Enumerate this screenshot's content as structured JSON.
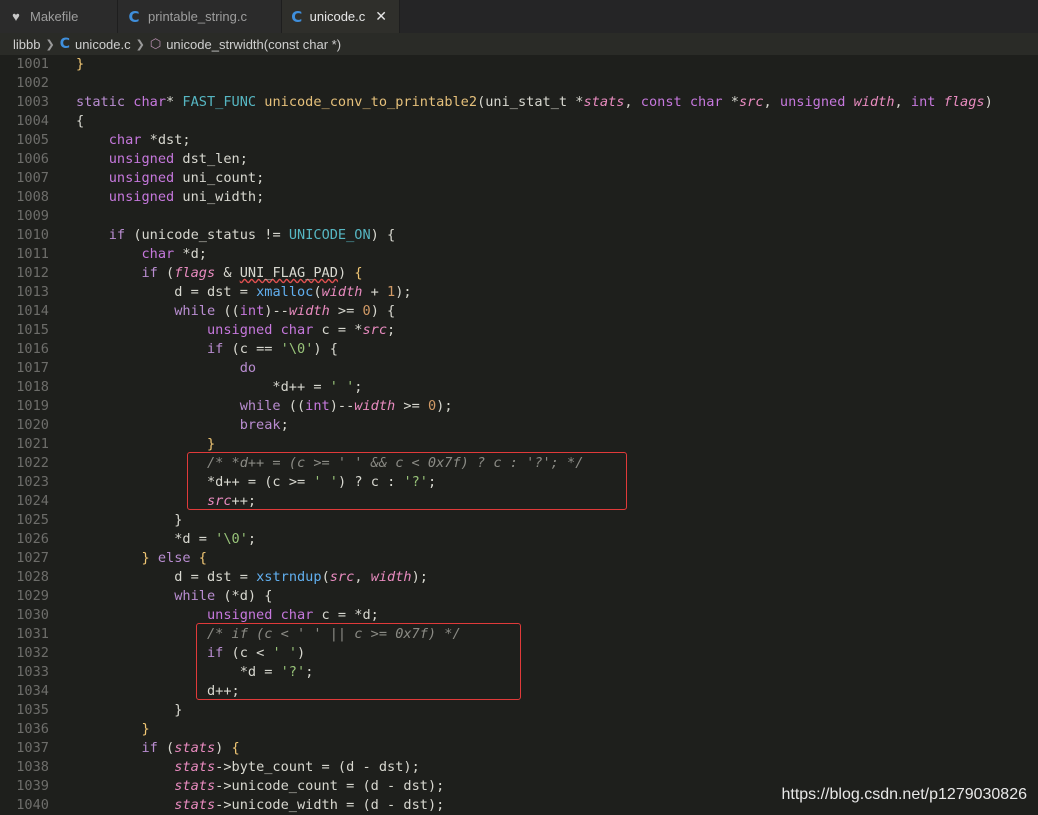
{
  "tabs": [
    {
      "label": "Makefile",
      "icon": "makefile-icon",
      "active": false
    },
    {
      "label": "printable_string.c",
      "icon": "c-file-icon",
      "active": false
    },
    {
      "label": "unicode.c",
      "icon": "c-file-icon",
      "active": true,
      "close": "✕"
    }
  ],
  "breadcrumb": {
    "folder": "libbb",
    "file": "unicode.c",
    "symbol": "unicode_strwidth(const char *)"
  },
  "lines": [
    {
      "n": "1001",
      "tokens": [
        [
          "brace",
          "}"
        ]
      ]
    },
    {
      "n": "1002",
      "tokens": []
    },
    {
      "n": "1003",
      "tokens": [
        [
          "kw",
          "static "
        ],
        [
          "type",
          "char"
        ],
        [
          "plain",
          "* "
        ],
        [
          "const",
          "FAST_FUNC "
        ],
        [
          "fn",
          "unicode_conv_to_printable2"
        ],
        [
          "plain",
          "("
        ],
        [
          "plain",
          "uni_stat_t "
        ],
        [
          "op",
          "*"
        ],
        [
          "param",
          "stats"
        ],
        [
          "plain",
          ", "
        ],
        [
          "type",
          "const char "
        ],
        [
          "op",
          "*"
        ],
        [
          "param",
          "src"
        ],
        [
          "plain",
          ", "
        ],
        [
          "type",
          "unsigned "
        ],
        [
          "param",
          "width"
        ],
        [
          "plain",
          ", "
        ],
        [
          "type",
          "int "
        ],
        [
          "param",
          "flags"
        ],
        [
          "plain",
          ")"
        ]
      ]
    },
    {
      "n": "1004",
      "tokens": [
        [
          "plain",
          "{"
        ]
      ]
    },
    {
      "n": "1005",
      "tokens": [
        [
          "plain",
          "    "
        ],
        [
          "type",
          "char "
        ],
        [
          "op",
          "*"
        ],
        [
          "plain",
          "dst;"
        ]
      ]
    },
    {
      "n": "1006",
      "tokens": [
        [
          "plain",
          "    "
        ],
        [
          "type",
          "unsigned "
        ],
        [
          "plain",
          "dst_len;"
        ]
      ]
    },
    {
      "n": "1007",
      "tokens": [
        [
          "plain",
          "    "
        ],
        [
          "type",
          "unsigned "
        ],
        [
          "plain",
          "uni_count;"
        ]
      ]
    },
    {
      "n": "1008",
      "tokens": [
        [
          "plain",
          "    "
        ],
        [
          "type",
          "unsigned "
        ],
        [
          "plain",
          "uni_width;"
        ]
      ]
    },
    {
      "n": "1009",
      "tokens": []
    },
    {
      "n": "1010",
      "tokens": [
        [
          "plain",
          "    "
        ],
        [
          "kw",
          "if "
        ],
        [
          "plain",
          "("
        ],
        [
          "plain",
          "unicode_status "
        ],
        [
          "op",
          "!= "
        ],
        [
          "const",
          "UNICODE_ON"
        ],
        [
          "plain",
          ") {"
        ]
      ]
    },
    {
      "n": "1011",
      "tokens": [
        [
          "plain",
          "        "
        ],
        [
          "type",
          "char "
        ],
        [
          "op",
          "*"
        ],
        [
          "plain",
          "d;"
        ]
      ]
    },
    {
      "n": "1012",
      "tokens": [
        [
          "plain",
          "        "
        ],
        [
          "kw",
          "if "
        ],
        [
          "plain",
          "("
        ],
        [
          "param",
          "flags"
        ],
        [
          "op",
          " & "
        ],
        [
          "macro",
          "UNI_FLAG_PAD"
        ],
        [
          "plain",
          ") "
        ],
        [
          "brace",
          "{"
        ]
      ]
    },
    {
      "n": "1013",
      "tokens": [
        [
          "plain",
          "            d "
        ],
        [
          "op",
          "= "
        ],
        [
          "plain",
          "dst "
        ],
        [
          "op",
          "= "
        ],
        [
          "fnb",
          "xmalloc"
        ],
        [
          "plain",
          "("
        ],
        [
          "param",
          "width"
        ],
        [
          "op",
          " + "
        ],
        [
          "num",
          "1"
        ],
        [
          "plain",
          ");"
        ]
      ]
    },
    {
      "n": "1014",
      "tokens": [
        [
          "plain",
          "            "
        ],
        [
          "kw",
          "while "
        ],
        [
          "plain",
          "(("
        ],
        [
          "type",
          "int"
        ],
        [
          "plain",
          ")"
        ],
        [
          "op",
          "--"
        ],
        [
          "param",
          "width"
        ],
        [
          "op",
          " >= "
        ],
        [
          "num",
          "0"
        ],
        [
          "plain",
          ") {"
        ]
      ]
    },
    {
      "n": "1015",
      "tokens": [
        [
          "plain",
          "                "
        ],
        [
          "type",
          "unsigned char "
        ],
        [
          "plain",
          "c "
        ],
        [
          "op",
          "= *"
        ],
        [
          "param",
          "src"
        ],
        [
          "plain",
          ";"
        ]
      ]
    },
    {
      "n": "1016",
      "tokens": [
        [
          "plain",
          "                "
        ],
        [
          "kw",
          "if "
        ],
        [
          "plain",
          "(c "
        ],
        [
          "op",
          "== "
        ],
        [
          "str",
          "'\\0'"
        ],
        [
          "plain",
          ") {"
        ]
      ]
    },
    {
      "n": "1017",
      "tokens": [
        [
          "plain",
          "                    "
        ],
        [
          "kw",
          "do"
        ]
      ]
    },
    {
      "n": "1018",
      "tokens": [
        [
          "plain",
          "                        "
        ],
        [
          "op",
          "*"
        ],
        [
          "plain",
          "d"
        ],
        [
          "op",
          "++ = "
        ],
        [
          "str",
          "' '"
        ],
        [
          "plain",
          ";"
        ]
      ]
    },
    {
      "n": "1019",
      "tokens": [
        [
          "plain",
          "                    "
        ],
        [
          "kw",
          "while "
        ],
        [
          "plain",
          "(("
        ],
        [
          "type",
          "int"
        ],
        [
          "plain",
          ")"
        ],
        [
          "op",
          "--"
        ],
        [
          "param",
          "width"
        ],
        [
          "op",
          " >= "
        ],
        [
          "num",
          "0"
        ],
        [
          "plain",
          ");"
        ]
      ]
    },
    {
      "n": "1020",
      "tokens": [
        [
          "plain",
          "                    "
        ],
        [
          "kw",
          "break"
        ],
        [
          "plain",
          ";"
        ]
      ]
    },
    {
      "n": "1021",
      "tokens": [
        [
          "plain",
          "                "
        ],
        [
          "brace",
          "}"
        ]
      ]
    },
    {
      "n": "1022",
      "tokens": [
        [
          "plain",
          "                "
        ],
        [
          "com",
          "/* *d++ = (c >= ' ' && c < 0x7f) ? c : '?'; */"
        ]
      ]
    },
    {
      "n": "1023",
      "tokens": [
        [
          "plain",
          "                "
        ],
        [
          "op",
          "*"
        ],
        [
          "plain",
          "d"
        ],
        [
          "op",
          "++ = "
        ],
        [
          "plain",
          "(c "
        ],
        [
          "op",
          ">= "
        ],
        [
          "str",
          "' '"
        ],
        [
          "plain",
          ") "
        ],
        [
          "op",
          "? "
        ],
        [
          "plain",
          "c "
        ],
        [
          "op",
          ": "
        ],
        [
          "str",
          "'?'"
        ],
        [
          "plain",
          ";"
        ]
      ]
    },
    {
      "n": "1024",
      "tokens": [
        [
          "plain",
          "                "
        ],
        [
          "param",
          "src"
        ],
        [
          "op",
          "++"
        ],
        [
          "plain",
          ";"
        ]
      ]
    },
    {
      "n": "1025",
      "tokens": [
        [
          "plain",
          "            }"
        ]
      ]
    },
    {
      "n": "1026",
      "tokens": [
        [
          "plain",
          "            "
        ],
        [
          "op",
          "*"
        ],
        [
          "plain",
          "d "
        ],
        [
          "op",
          "= "
        ],
        [
          "str",
          "'\\0'"
        ],
        [
          "plain",
          ";"
        ]
      ]
    },
    {
      "n": "1027",
      "tokens": [
        [
          "plain",
          "        "
        ],
        [
          "brace",
          "} "
        ],
        [
          "kw",
          "else "
        ],
        [
          "brace",
          "{"
        ]
      ]
    },
    {
      "n": "1028",
      "tokens": [
        [
          "plain",
          "            d "
        ],
        [
          "op",
          "= "
        ],
        [
          "plain",
          "dst "
        ],
        [
          "op",
          "= "
        ],
        [
          "fnb",
          "xstrndup"
        ],
        [
          "plain",
          "("
        ],
        [
          "param",
          "src"
        ],
        [
          "plain",
          ", "
        ],
        [
          "param",
          "width"
        ],
        [
          "plain",
          ");"
        ]
      ]
    },
    {
      "n": "1029",
      "tokens": [
        [
          "plain",
          "            "
        ],
        [
          "kw",
          "while "
        ],
        [
          "plain",
          "("
        ],
        [
          "op",
          "*"
        ],
        [
          "plain",
          "d) {"
        ]
      ]
    },
    {
      "n": "1030",
      "tokens": [
        [
          "plain",
          "                "
        ],
        [
          "type",
          "unsigned char "
        ],
        [
          "plain",
          "c "
        ],
        [
          "op",
          "= *"
        ],
        [
          "plain",
          "d;"
        ]
      ]
    },
    {
      "n": "1031",
      "tokens": [
        [
          "plain",
          "                "
        ],
        [
          "com",
          "/* if (c < ' ' || c >= 0x7f) */"
        ]
      ]
    },
    {
      "n": "1032",
      "tokens": [
        [
          "plain",
          "                "
        ],
        [
          "kw",
          "if "
        ],
        [
          "plain",
          "(c "
        ],
        [
          "op",
          "< "
        ],
        [
          "str",
          "' '"
        ],
        [
          "plain",
          ")"
        ]
      ]
    },
    {
      "n": "1033",
      "tokens": [
        [
          "plain",
          "                    "
        ],
        [
          "op",
          "*"
        ],
        [
          "plain",
          "d "
        ],
        [
          "op",
          "= "
        ],
        [
          "str",
          "'?'"
        ],
        [
          "plain",
          ";"
        ]
      ]
    },
    {
      "n": "1034",
      "tokens": [
        [
          "plain",
          "                d"
        ],
        [
          "op",
          "++"
        ],
        [
          "plain",
          ";"
        ]
      ]
    },
    {
      "n": "1035",
      "tokens": [
        [
          "plain",
          "            }"
        ]
      ]
    },
    {
      "n": "1036",
      "tokens": [
        [
          "plain",
          "        "
        ],
        [
          "brace",
          "}"
        ]
      ]
    },
    {
      "n": "1037",
      "tokens": [
        [
          "plain",
          "        "
        ],
        [
          "kw",
          "if "
        ],
        [
          "plain",
          "("
        ],
        [
          "param",
          "stats"
        ],
        [
          "plain",
          ") "
        ],
        [
          "brace",
          "{"
        ]
      ]
    },
    {
      "n": "1038",
      "tokens": [
        [
          "plain",
          "            "
        ],
        [
          "param",
          "stats"
        ],
        [
          "op",
          "->"
        ],
        [
          "plain",
          "byte_count "
        ],
        [
          "op",
          "= "
        ],
        [
          "plain",
          "(d "
        ],
        [
          "op",
          "- "
        ],
        [
          "plain",
          "dst);"
        ]
      ]
    },
    {
      "n": "1039",
      "tokens": [
        [
          "plain",
          "            "
        ],
        [
          "param",
          "stats"
        ],
        [
          "op",
          "->"
        ],
        [
          "plain",
          "unicode_count "
        ],
        [
          "op",
          "= "
        ],
        [
          "plain",
          "(d "
        ],
        [
          "op",
          "- "
        ],
        [
          "plain",
          "dst);"
        ]
      ]
    },
    {
      "n": "1040",
      "tokens": [
        [
          "plain",
          "            "
        ],
        [
          "param",
          "stats"
        ],
        [
          "op",
          "->"
        ],
        [
          "plain",
          "unicode_width "
        ],
        [
          "op",
          "= "
        ],
        [
          "plain",
          "(d "
        ],
        [
          "op",
          "- "
        ],
        [
          "plain",
          "dst);"
        ]
      ]
    }
  ],
  "watermark": "https://blog.csdn.net/p1279030826",
  "colors": {
    "highlight_box": "#e03a3a",
    "c_icon": "#3f8fdc"
  }
}
